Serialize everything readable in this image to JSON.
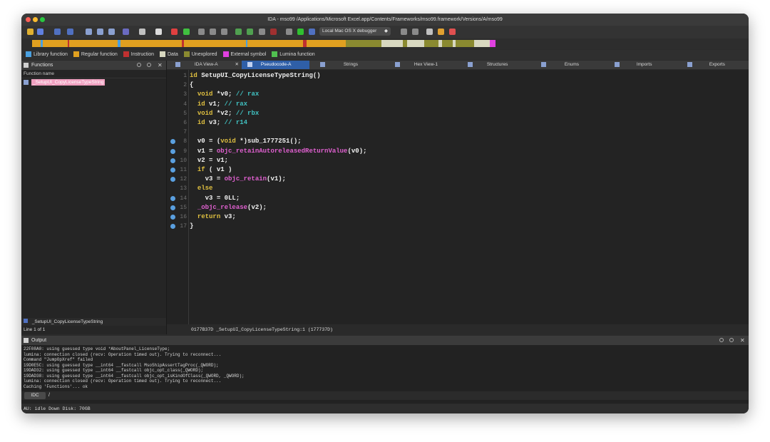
{
  "window": {
    "title": "IDA - mso99 /Applications/Microsoft Excel.app/Contents/Frameworks/mso99.framework/Versions/A/mso99"
  },
  "toolbar": {
    "debugger_label": "Local Mac OS X debugger",
    "debugger_arrow": "◆"
  },
  "legend": {
    "items": [
      {
        "label": "Library function",
        "color": "#4aa0e0"
      },
      {
        "label": "Regular function",
        "color": "#e0a020"
      },
      {
        "label": "Instruction",
        "color": "#c03030"
      },
      {
        "label": "Data",
        "color": "#d8d8c0"
      },
      {
        "label": "Unexplored",
        "color": "#8a8a30"
      },
      {
        "label": "External symbol",
        "color": "#e040e0"
      },
      {
        "label": "Lumina function",
        "color": "#50c050"
      }
    ]
  },
  "functions_panel": {
    "title": "Functions",
    "column_header": "Function name",
    "selected_function": "_SetupUI_CopyLicenseTypeString",
    "bottom_item": "_SetupUI_CopyLicenseTypeString",
    "line_status": "Line 1 of 1"
  },
  "tabs": [
    {
      "label": "IDA View-A",
      "active": false
    },
    {
      "label": "Pseudocode-A",
      "active": true
    },
    {
      "label": "Strings",
      "active": false
    },
    {
      "label": "Hex View-1",
      "active": false
    },
    {
      "label": "Structures",
      "active": false
    },
    {
      "label": "Enums",
      "active": false
    },
    {
      "label": "Imports",
      "active": false
    },
    {
      "label": "Exports",
      "active": false
    }
  ],
  "code": {
    "lines": [
      {
        "n": "1",
        "text": "id SetupUI_CopyLicenseTypeString()",
        "bp": false
      },
      {
        "n": "2",
        "text": "{",
        "bp": false
      },
      {
        "n": "3",
        "text": "  void *v0; // rax",
        "bp": false
      },
      {
        "n": "4",
        "text": "  id v1; // rax",
        "bp": false
      },
      {
        "n": "5",
        "text": "  void *v2; // rbx",
        "bp": false
      },
      {
        "n": "6",
        "text": "  id v3; // r14",
        "bp": false
      },
      {
        "n": "7",
        "text": "",
        "bp": false
      },
      {
        "n": "8",
        "text": "  v0 = (void *)sub_1777251();",
        "bp": true
      },
      {
        "n": "9",
        "text": "  v1 = objc_retainAutoreleasedReturnValue(v0);",
        "bp": true
      },
      {
        "n": "10",
        "text": "  v2 = v1;",
        "bp": true
      },
      {
        "n": "11",
        "text": "  if ( v1 )",
        "bp": true
      },
      {
        "n": "12",
        "text": "    v3 = objc_retain(v1);",
        "bp": true
      },
      {
        "n": "13",
        "text": "  else",
        "bp": false
      },
      {
        "n": "14",
        "text": "    v3 = 0LL;",
        "bp": true
      },
      {
        "n": "15",
        "text": "  _objc_release(v2);",
        "bp": true
      },
      {
        "n": "16",
        "text": "  return v3;",
        "bp": true
      },
      {
        "n": "17",
        "text": "}",
        "bp": true
      }
    ],
    "status": "0177B37D _SetupUI_CopyLicenseTypeString:1 (177737D)"
  },
  "output": {
    "title": "Output",
    "lines": [
      "22F08A0: using guessed type void *AboutPanel_LicenseType;",
      "lumina: connection closed (recv: Operation timed out). Trying to reconnect...",
      "Command \"JumpOpXref\" failed",
      "19D0E5C: using guessed type __int64 __fastcall MsoShipAssertTagProc(_QWORD);",
      "19DAD32: using guessed type __int64 __fastcall objc_opt_class(_QWORD);",
      "19DAD38: using guessed type __int64 __fastcall objc_opt_isKindOfClass(_QWORD, _QWORD);",
      "lumina: connection closed (recv: Operation timed out). Trying to reconnect...",
      "Caching 'Functions'... ok"
    ],
    "idc_label": "IDC",
    "idc_value": "/"
  },
  "status_bar": {
    "text": "AU:  idle   Down     Disk: 70GB"
  }
}
